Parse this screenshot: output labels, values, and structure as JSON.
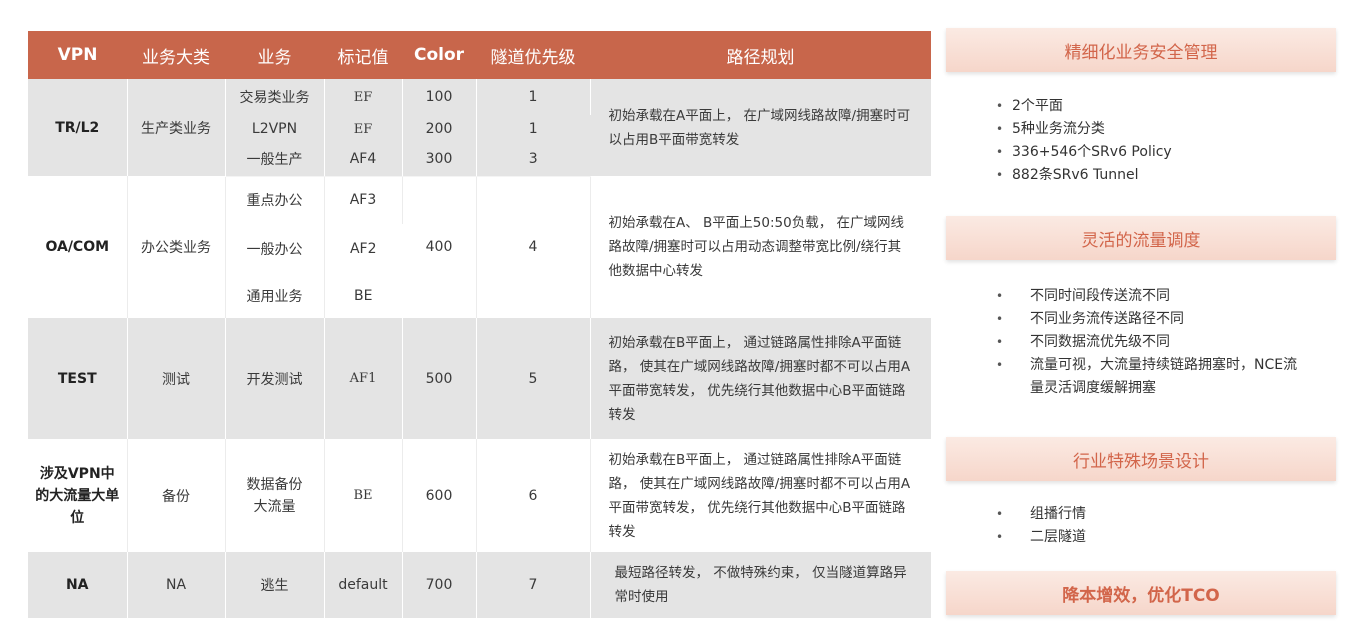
{
  "table": {
    "headers": [
      "VPN",
      "业务大类",
      "业务",
      "标记值",
      "Color",
      "隧道优先级",
      "路径规划"
    ],
    "groups": [
      {
        "vpn": "TR/L2",
        "category": "生产类业务",
        "rows": [
          {
            "service": "交易类业务",
            "mark": "EF",
            "color": "100",
            "priority": "1"
          },
          {
            "service": "L2VPN",
            "mark": "EF",
            "color": "200",
            "priority": "1"
          },
          {
            "service": "一般生产",
            "mark": "AF4",
            "color": "300",
            "priority": "3"
          }
        ],
        "route": "初始承载在A平面上， 在广域网线路故障/拥塞时可以占用B平面带宽转发"
      },
      {
        "vpn": "OA/COM",
        "category": "办公类业务",
        "rows": [
          {
            "service": "重点办公",
            "mark": "AF3"
          },
          {
            "service": "一般办公",
            "mark": "AF2"
          },
          {
            "service": "通用业务",
            "mark": "BE"
          }
        ],
        "color": "400",
        "priority": "4",
        "route": "初始承载在A、 B平面上50:50负载， 在广域网线路故障/拥塞时可以占用动态调整带宽比例/绕行其他数据中心转发"
      },
      {
        "vpn": "TEST",
        "category": "测试",
        "service": "开发测试",
        "mark": "AF1",
        "color": "500",
        "priority": "5",
        "route": "初始承载在B平面上， 通过链路属性排除A平面链路， 使其在广域网线路故障/拥塞时都不可以占用A平面带宽转发， 优先绕行其他数据中心B平面链路转发"
      },
      {
        "vpn": "涉及VPN中的大流量大单位",
        "category": "备份",
        "service": "数据备份大流量",
        "mark": "BE",
        "color": "600",
        "priority": "6",
        "route": "初始承载在B平面上， 通过链路属性排除A平面链路， 使其在广域网线路故障/拥塞时都不可以占用A平面带宽转发， 优先绕行其他数据中心B平面链路转发"
      },
      {
        "vpn": "NA",
        "category": "NA",
        "service": "逃生",
        "mark": "default",
        "color": "700",
        "priority": "7",
        "route": "最短路径转发， 不做特殊约束， 仅当隧道算路异常时使用"
      }
    ]
  },
  "panel": {
    "sections": [
      {
        "title": "精细化业务安全管理",
        "items": [
          "2个平面",
          "5种业务流分类",
          "336+546个SRv6 Policy",
          "882条SRv6 Tunnel"
        ]
      },
      {
        "title": "灵活的流量调度",
        "items": [
          "不同时间段传送流不同",
          "不同业务流传送路径不同",
          "不同数据流优先级不同",
          "流量可视，大流量持续链路拥塞时，NCE流量灵活调度缓解拥塞"
        ]
      },
      {
        "title": "行业特殊场景设计",
        "items": [
          "组播行情",
          "二层隧道"
        ]
      },
      {
        "title": "降本增效，优化TCO",
        "items": []
      }
    ]
  },
  "colors": {
    "header_bg": "#c8664b",
    "banner_text": "#d2654a",
    "row_grey": "#e4e4e4"
  }
}
